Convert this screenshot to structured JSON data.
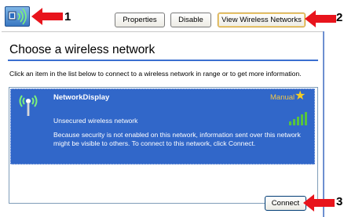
{
  "toolbar": {
    "properties_label": "Properties",
    "disable_label": "Disable",
    "view_networks_label": "View Wireless Networks"
  },
  "callouts": [
    "1",
    "2",
    "3"
  ],
  "panel": {
    "title": "Choose a wireless network",
    "instructions": "Click an item in the list below to connect to a wireless network in range or to get more information."
  },
  "network": {
    "name": "NetworkDisplay",
    "mode": "Manual",
    "security_status": "Unsecured wireless network",
    "warning": "Because security is not enabled on this network, information sent over this network might be visible to others. To connect to this network, click Connect.",
    "signal_bars": 5,
    "signal_max": 5,
    "preferred": true
  },
  "actions": {
    "connect_label": "Connect"
  },
  "colors": {
    "selection_bg": "#3167c9",
    "callout_arrow": "#e8141c",
    "manual_text": "#f0c64a",
    "signal_green": "#58c43c"
  },
  "icons": {
    "network_icon": "wireless-network-icon",
    "antenna": "wireless-antenna-icon",
    "star": "star-icon",
    "signal": "signal-strength-icon",
    "arrow": "red-arrow-icon"
  }
}
